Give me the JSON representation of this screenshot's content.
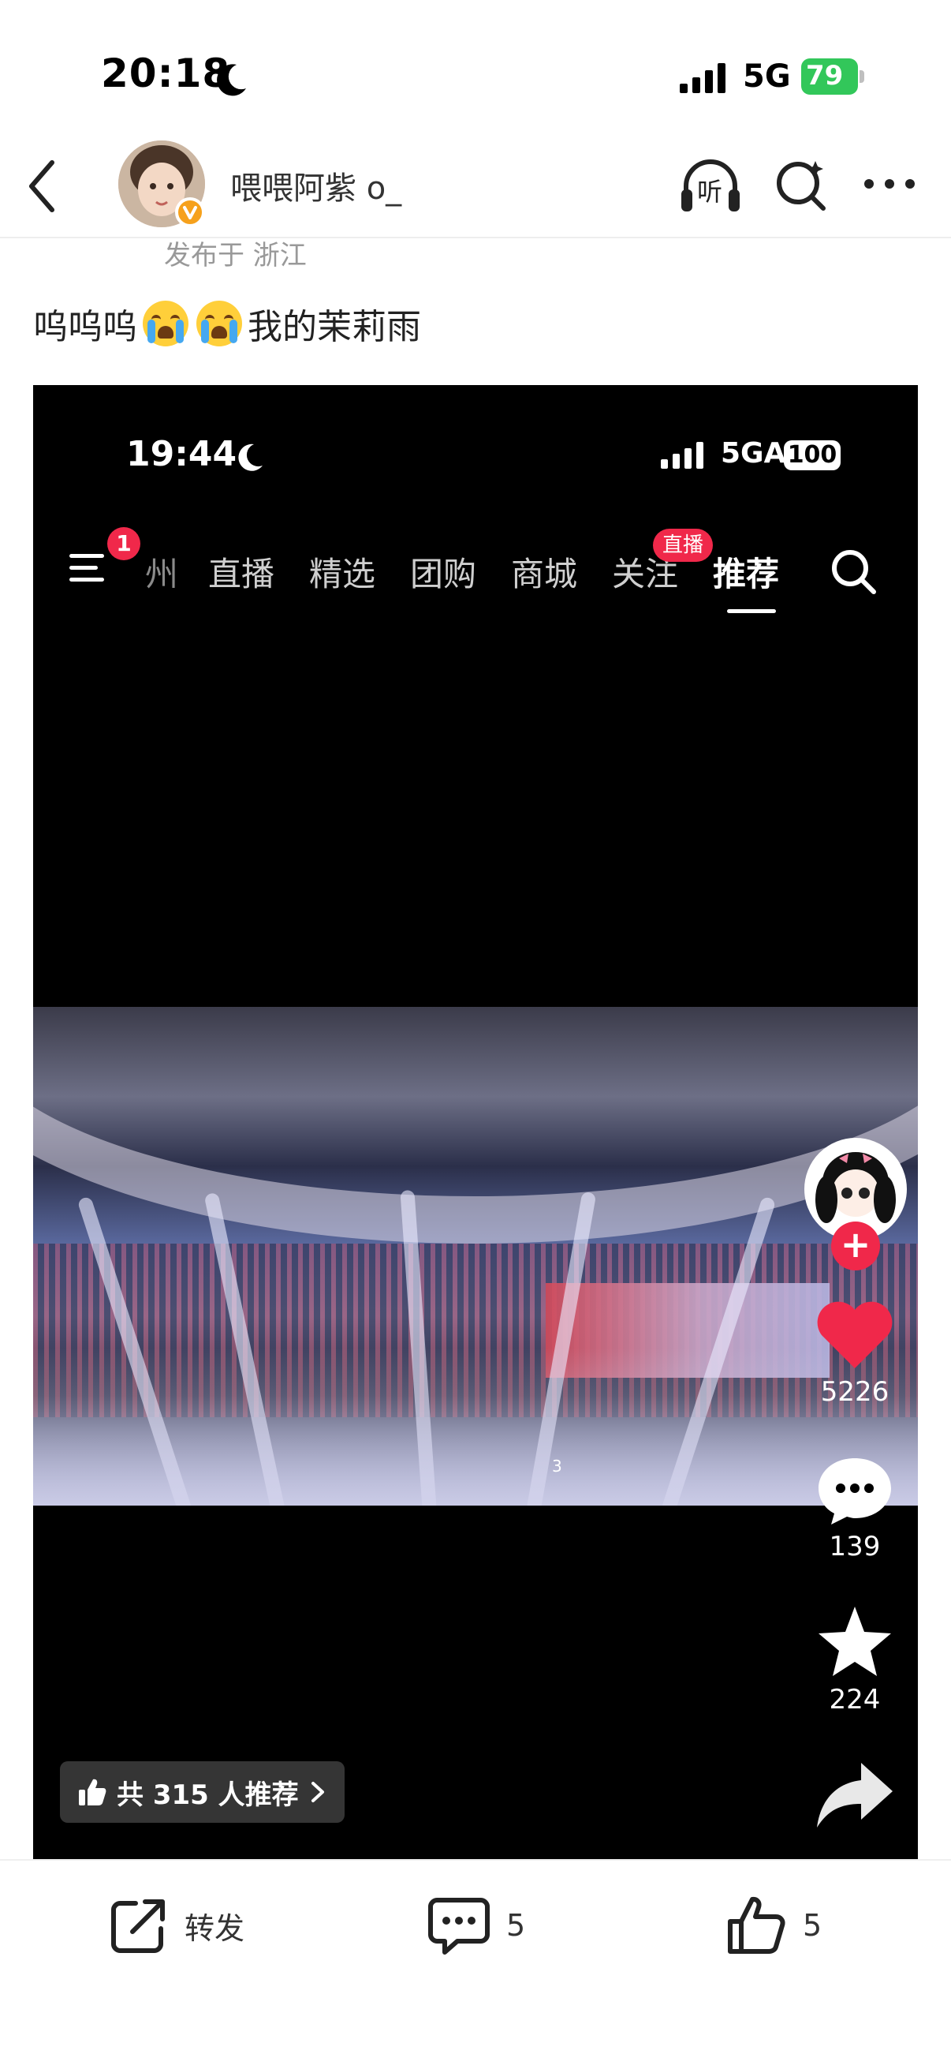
{
  "status_bar": {
    "time": "20:18",
    "network": "5G",
    "battery": "79"
  },
  "header": {
    "username": "喂喂阿紫 o_",
    "location": "发布于 浙江",
    "listen_label": "听"
  },
  "post": {
    "text_before": "呜呜呜",
    "text_after": "我的茉莉雨",
    "emoji": "crying-face"
  },
  "embedded_screen": {
    "status_bar": {
      "time": "19:44",
      "network": "5GA",
      "battery": "100"
    },
    "menu_badge": "1",
    "tabs": [
      "州",
      "直播",
      "精选",
      "团购",
      "商城",
      "关注",
      "推荐"
    ],
    "active_tab": "推荐",
    "live_badge": "直播",
    "video_watermark": "3",
    "likes": "5226",
    "comments": "139",
    "favorites": "224",
    "recommend_label": "共 315 人推荐"
  },
  "bottom_bar": {
    "repost_label": "转发",
    "comment_count": "5",
    "like_count": "5"
  },
  "colors": {
    "accent_red": "#f0284a",
    "battery_green": "#32c75a",
    "verified_orange": "#f6a11c"
  }
}
